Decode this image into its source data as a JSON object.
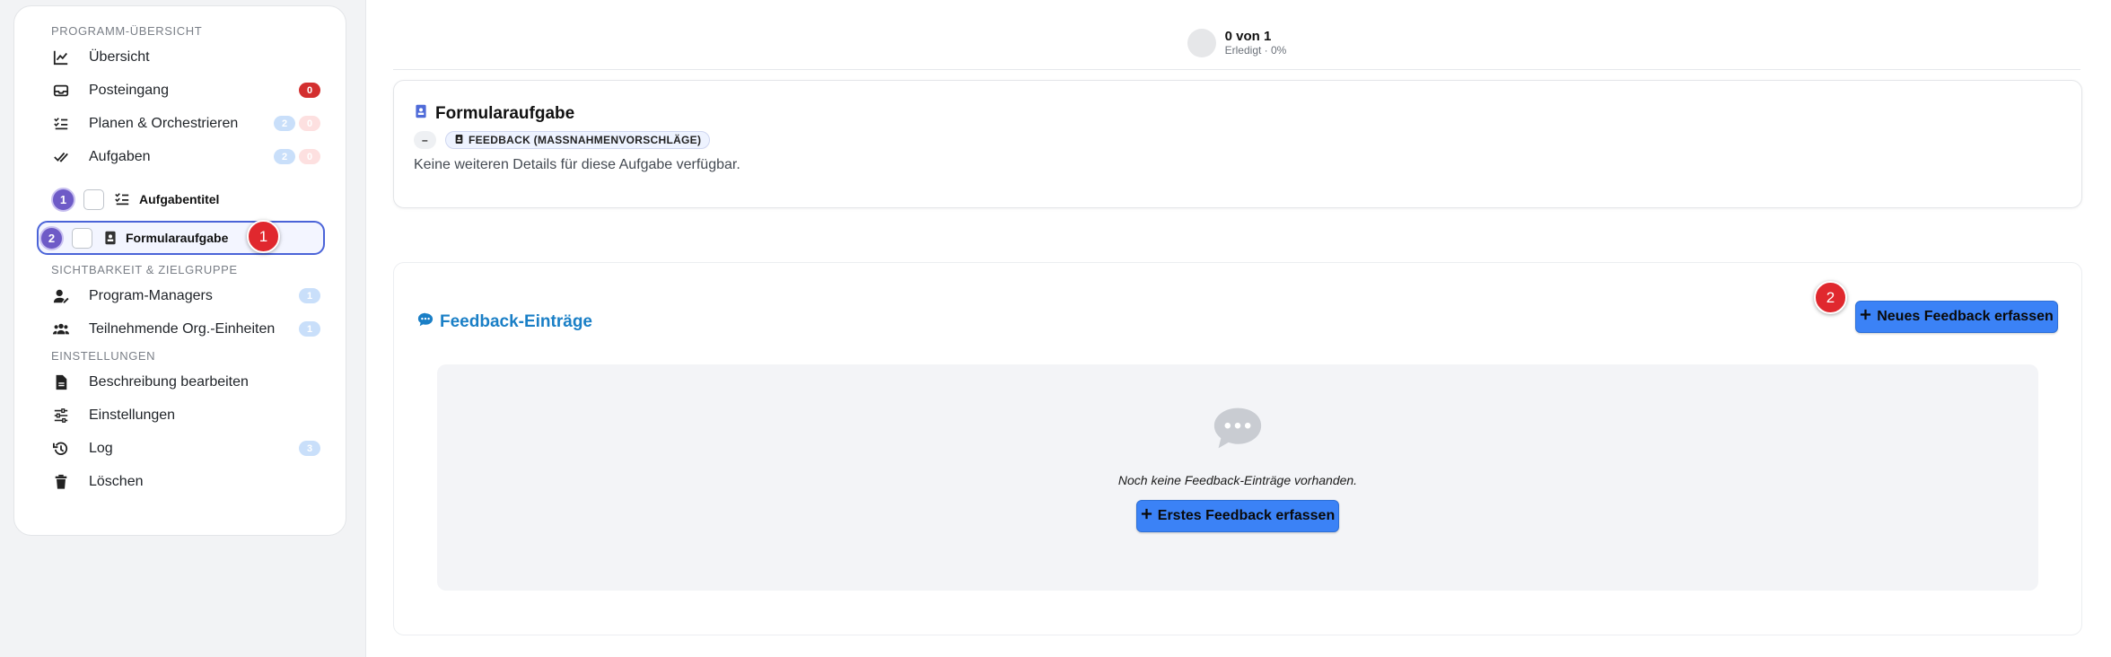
{
  "sidebar": {
    "sections": [
      {
        "title": "PROGRAMM-ÜBERSICHT"
      },
      {
        "title": "SICHTBARKEIT & ZIELGRUPPE"
      },
      {
        "title": "EINSTELLUNGEN"
      }
    ],
    "overview": {
      "label": "Übersicht",
      "icon": "chart-line-icon"
    },
    "inbox": {
      "label": "Posteingang",
      "icon": "inbox-icon",
      "badge": "0"
    },
    "plan": {
      "label": "Planen & Orchestrieren",
      "icon": "checklist-icon",
      "badge_blue": "2",
      "badge_red": "0"
    },
    "tasks": {
      "label": "Aufgaben",
      "icon": "double-check-icon",
      "badge_blue": "2",
      "badge_red": "0"
    },
    "task_items": [
      {
        "step": "1",
        "label": "Aufgabentitel",
        "icon": "checklist-icon"
      },
      {
        "step": "2",
        "label": "Formularaufgabe",
        "icon": "form-icon"
      }
    ],
    "managers": {
      "label": "Program-Managers",
      "icon": "user-edit-icon",
      "badge": "1"
    },
    "org_units": {
      "label": "Teilnehmende Org.-Einheiten",
      "icon": "users-icon",
      "badge": "1"
    },
    "edit_desc": {
      "label": "Beschreibung bearbeiten",
      "icon": "file-icon"
    },
    "settings": {
      "label": "Einstellungen",
      "icon": "sliders-icon"
    },
    "log": {
      "label": "Log",
      "icon": "history-icon",
      "badge": "3"
    },
    "delete": {
      "label": "Löschen",
      "icon": "trash-icon"
    }
  },
  "markers": {
    "one": "1",
    "two": "2"
  },
  "progress": {
    "count": "0 von 1",
    "sub": "Erledigt · 0%"
  },
  "task_card": {
    "title": "Formularaufgabe",
    "chip_dash": "–",
    "chip_type": "FEEDBACK (MASSNAHMENVORSCHLÄGE)",
    "description": "Keine weiteren Details für diese Aufgabe verfügbar."
  },
  "feedback": {
    "title": "Feedback-Einträge",
    "new_button": "Neues Feedback erfassen",
    "empty_text": "Noch keine Feedback-Einträge vorhanden.",
    "first_button": "Erstes Feedback erfassen"
  },
  "colors": {
    "accent": "#3b82f6",
    "step": "#6e5bc7",
    "marker": "#e0282e",
    "feedback_title": "#1a7fc6"
  }
}
